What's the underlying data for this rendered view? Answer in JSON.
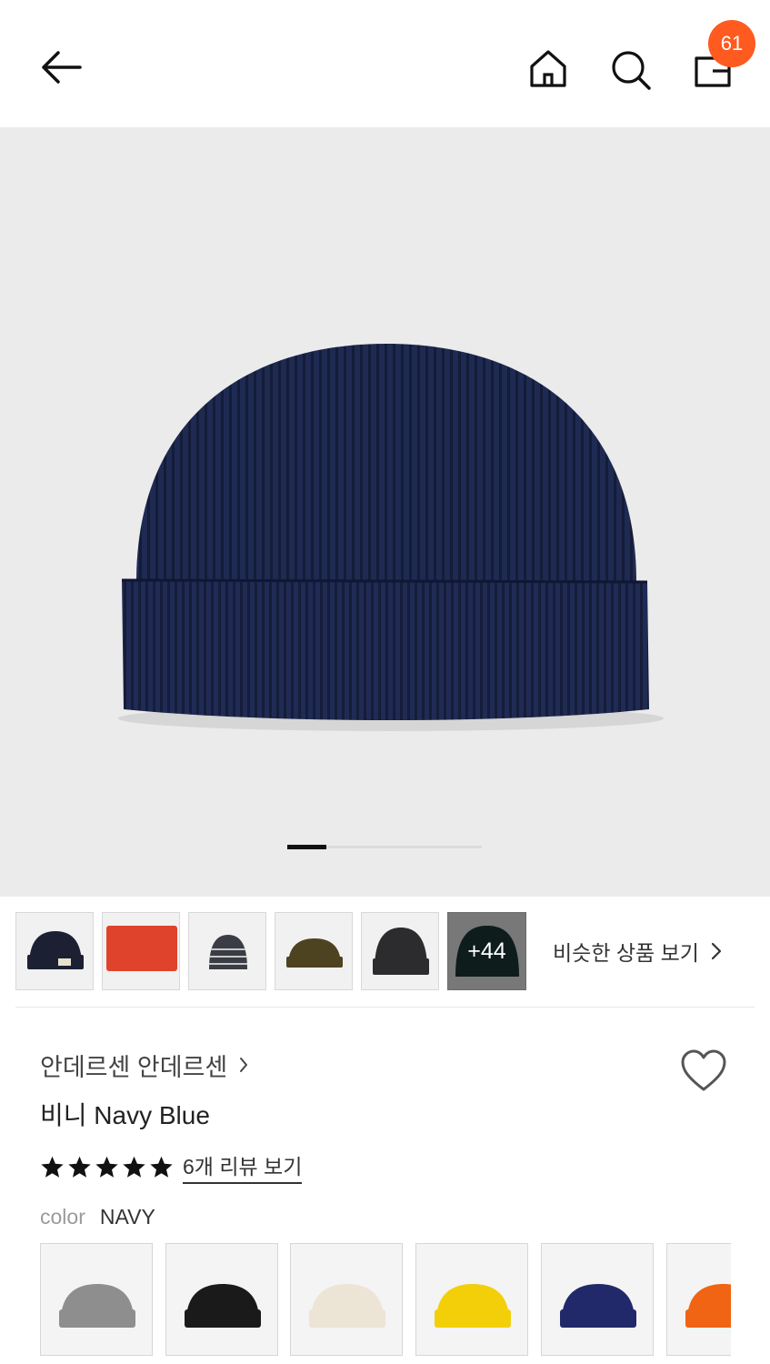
{
  "header": {
    "back_icon": "arrow-left-icon",
    "home_icon": "home-icon",
    "search_icon": "search-icon",
    "bag_icon": "shopping-bag-icon",
    "cart_count": "61",
    "badge_color": "#ff5a1f"
  },
  "hero": {
    "image": "navy ribbed beanie photo",
    "background": "#ebebeb",
    "pager": {
      "current": 1
    }
  },
  "thumbnails": {
    "items": [
      {
        "color": "#1c2033"
      },
      {
        "color": "#e0432b"
      },
      {
        "color": "#3a3d45"
      },
      {
        "color": "#4e4320"
      },
      {
        "color": "#2c2c2e"
      },
      {
        "color": "#1d3a36"
      }
    ],
    "more_label": "+44",
    "similar_label": "비슷한 상품 보기"
  },
  "product": {
    "brand": "안데르센 안데르센",
    "name": "비니 Navy Blue",
    "rating_stars": 5,
    "review_link": "6개 리뷰 보기",
    "color_label": "color",
    "color_value": "NAVY"
  },
  "swatches": [
    {
      "color": "#8e8e8e"
    },
    {
      "color": "#1a1a1a"
    },
    {
      "color": "#ece5d6"
    },
    {
      "color": "#f2cf08"
    },
    {
      "color": "#22296a"
    },
    {
      "color": "#f06414"
    }
  ]
}
